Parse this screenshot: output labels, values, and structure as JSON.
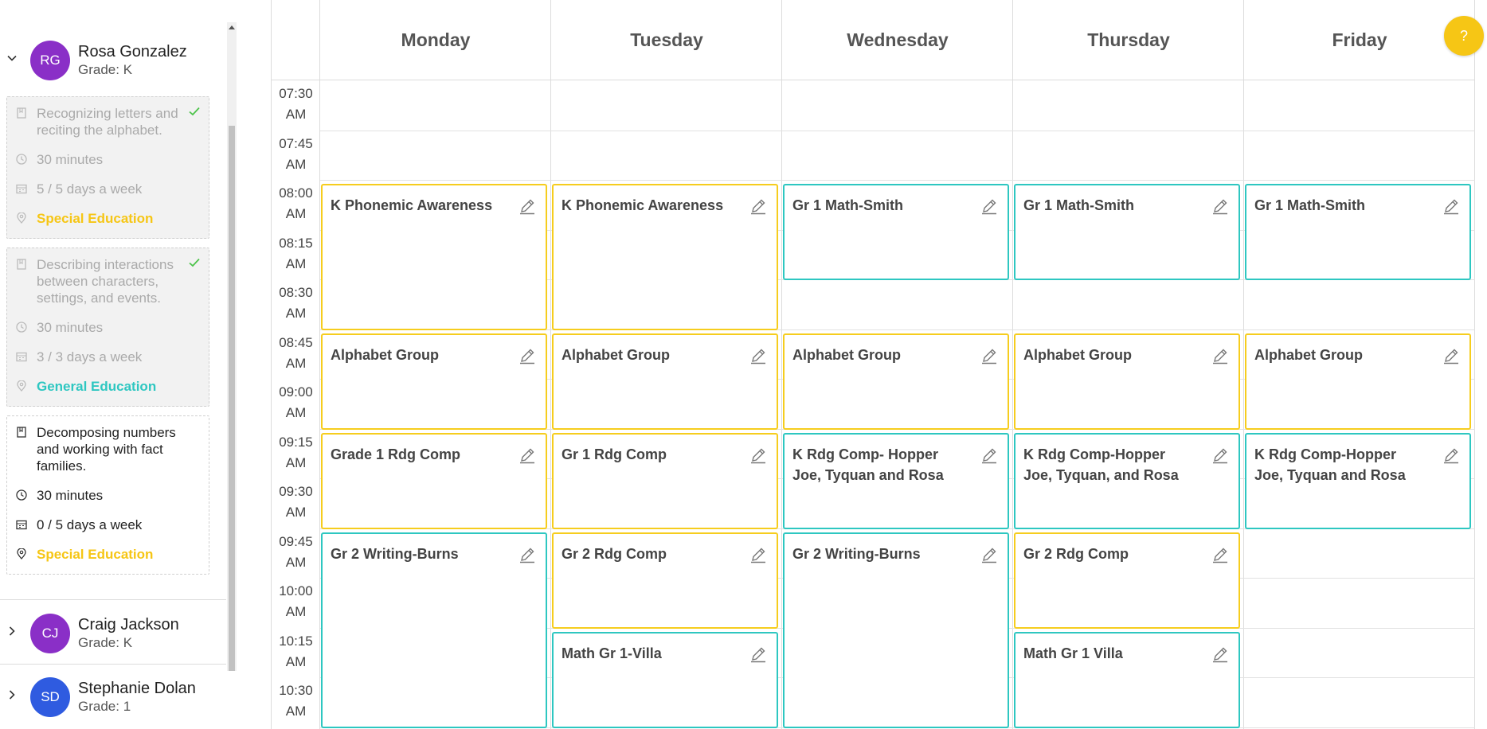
{
  "colors": {
    "special": "#f6c615",
    "general": "#2ec7c1"
  },
  "students": [
    {
      "initials": "RG",
      "name": "Rosa Gonzalez",
      "grade": "Grade: K",
      "avatar_color": "#8a2fc7",
      "expanded": true
    },
    {
      "initials": "CJ",
      "name": "Craig Jackson",
      "grade": "Grade: K",
      "avatar_color": "#8a2fc7",
      "expanded": false
    },
    {
      "initials": "SD",
      "name": "Stephanie Dolan",
      "grade": "Grade: 1",
      "avatar_color": "#2f5be0",
      "expanded": false
    }
  ],
  "goals": [
    {
      "title": "Recognizing letters and reciting the alphabet.",
      "duration": "30 minutes",
      "frequency": "5 / 5 days a week",
      "setting": "Special Education",
      "setting_type": "special",
      "completed": true
    },
    {
      "title": "Describing interactions between characters, settings, and events.",
      "duration": "30 minutes",
      "frequency": "3 / 3 days a week",
      "setting": "General Education",
      "setting_type": "general",
      "completed": true
    },
    {
      "title": "Decomposing numbers and working with fact families.",
      "duration": "30 minutes",
      "frequency": "0 / 5 days a week",
      "setting": "Special Education",
      "setting_type": "special",
      "completed": false
    }
  ],
  "days": [
    "Monday",
    "Tuesday",
    "Wednesday",
    "Thursday",
    "Friday"
  ],
  "times": [
    "07:30 AM",
    "07:45 AM",
    "08:00 AM",
    "08:15 AM",
    "08:30 AM",
    "08:45 AM",
    "09:00 AM",
    "09:15 AM",
    "09:30 AM",
    "09:45 AM",
    "10:00 AM",
    "10:15 AM",
    "10:30 AM"
  ],
  "events": [
    {
      "day": 0,
      "start": "08:00 AM",
      "end": "08:45 AM",
      "title": "K Phonemic Awareness",
      "type": "special"
    },
    {
      "day": 1,
      "start": "08:00 AM",
      "end": "08:45 AM",
      "title": "K Phonemic Awareness",
      "type": "special"
    },
    {
      "day": 2,
      "start": "08:00 AM",
      "end": "08:30 AM",
      "title": "Gr 1 Math-Smith",
      "type": "general"
    },
    {
      "day": 3,
      "start": "08:00 AM",
      "end": "08:30 AM",
      "title": "Gr 1 Math-Smith",
      "type": "general"
    },
    {
      "day": 4,
      "start": "08:00 AM",
      "end": "08:30 AM",
      "title": "Gr 1 Math-Smith",
      "type": "general"
    },
    {
      "day": 0,
      "start": "08:45 AM",
      "end": "09:15 AM",
      "title": "Alphabet Group",
      "type": "special"
    },
    {
      "day": 1,
      "start": "08:45 AM",
      "end": "09:15 AM",
      "title": "Alphabet Group",
      "type": "special"
    },
    {
      "day": 2,
      "start": "08:45 AM",
      "end": "09:15 AM",
      "title": "Alphabet Group",
      "type": "special"
    },
    {
      "day": 3,
      "start": "08:45 AM",
      "end": "09:15 AM",
      "title": "Alphabet Group",
      "type": "special"
    },
    {
      "day": 4,
      "start": "08:45 AM",
      "end": "09:15 AM",
      "title": "Alphabet Group",
      "type": "special"
    },
    {
      "day": 0,
      "start": "09:15 AM",
      "end": "09:45 AM",
      "title": "Grade 1 Rdg Comp",
      "type": "special"
    },
    {
      "day": 1,
      "start": "09:15 AM",
      "end": "09:45 AM",
      "title": "Gr 1 Rdg Comp",
      "type": "special"
    },
    {
      "day": 2,
      "start": "09:15 AM",
      "end": "09:45 AM",
      "title": "K Rdg Comp- Hopper Joe, Tyquan and Rosa",
      "type": "general"
    },
    {
      "day": 3,
      "start": "09:15 AM",
      "end": "09:45 AM",
      "title": "K Rdg Comp-Hopper Joe, Tyquan, and Rosa",
      "type": "general"
    },
    {
      "day": 4,
      "start": "09:15 AM",
      "end": "09:45 AM",
      "title": "K Rdg Comp-Hopper Joe, Tyquan and Rosa",
      "type": "general"
    },
    {
      "day": 0,
      "start": "09:45 AM",
      "end": "10:45 AM",
      "title": "Gr 2 Writing-Burns",
      "type": "general"
    },
    {
      "day": 1,
      "start": "09:45 AM",
      "end": "10:15 AM",
      "title": "Gr 2 Rdg Comp",
      "type": "special"
    },
    {
      "day": 2,
      "start": "09:45 AM",
      "end": "10:45 AM",
      "title": "Gr 2 Writing-Burns",
      "type": "general"
    },
    {
      "day": 3,
      "start": "09:45 AM",
      "end": "10:15 AM",
      "title": "Gr 2 Rdg Comp",
      "type": "special"
    },
    {
      "day": 1,
      "start": "10:15 AM",
      "end": "10:45 AM",
      "title": "Math Gr 1-Villa",
      "type": "general"
    },
    {
      "day": 3,
      "start": "10:15 AM",
      "end": "10:45 AM",
      "title": "Math Gr 1 Villa",
      "type": "general"
    }
  ],
  "help_label": "?"
}
